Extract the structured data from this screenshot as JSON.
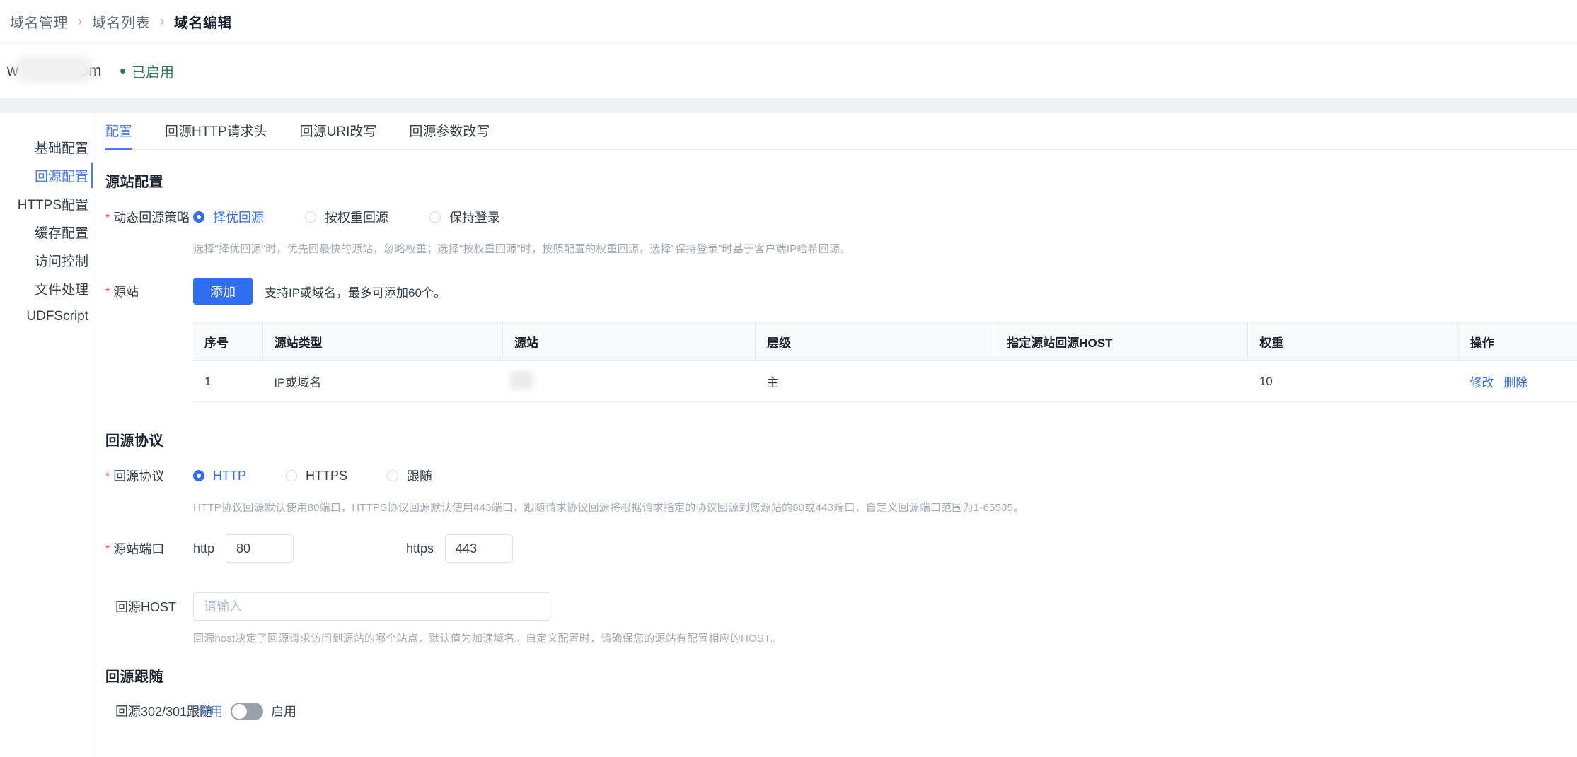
{
  "breadcrumb": {
    "items": [
      {
        "label": "域名管理",
        "current": false
      },
      {
        "label": "域名列表",
        "current": false
      },
      {
        "label": "域名编辑",
        "current": true
      }
    ],
    "separator": "›"
  },
  "domain_header": {
    "name_prefix": "w",
    "name_suffix": "om",
    "status": "已启用",
    "status_color": "#2e7d4f"
  },
  "sidebar": {
    "items": [
      {
        "label": "基础配置",
        "active": false
      },
      {
        "label": "回源配置",
        "active": true
      },
      {
        "label": "HTTPS配置",
        "active": false
      },
      {
        "label": "缓存配置",
        "active": false
      },
      {
        "label": "访问控制",
        "active": false
      },
      {
        "label": "文件处理",
        "active": false
      },
      {
        "label": "UDFScript",
        "active": false
      }
    ],
    "accent_color": "#4a7bf7"
  },
  "tabs": [
    {
      "label": "配置",
      "active": true
    },
    {
      "label": "回源HTTP请求头",
      "active": false
    },
    {
      "label": "回源URI改写",
      "active": false
    },
    {
      "label": "回源参数改写",
      "active": false
    }
  ],
  "origin_section": {
    "title": "源站配置",
    "policy": {
      "label": "动态回源策略",
      "required": true,
      "options": [
        {
          "label": "择优回源",
          "checked": true
        },
        {
          "label": "按权重回源",
          "checked": false
        },
        {
          "label": "保持登录",
          "checked": false
        }
      ],
      "hint": "选择\"择优回源\"时，优先回最快的源站，忽略权重；选择\"按权重回源\"时，按照配置的权重回源，选择\"保持登录\"时基于客户端IP哈希回源。"
    },
    "origin": {
      "label": "源站",
      "required": true,
      "add_button": "添加",
      "add_note": "支持IP或域名，最多可添加60个。"
    },
    "table": {
      "headers": [
        "序号",
        "源站类型",
        "源站",
        "层级",
        "指定源站回源HOST",
        "权重",
        "操作"
      ],
      "rows": [
        {
          "index": "1",
          "type": "IP或域名",
          "origin": "5",
          "level": "主",
          "host": "",
          "weight": "10",
          "actions": [
            "修改",
            "删除"
          ]
        }
      ]
    }
  },
  "protocol_section": {
    "title": "回源协议",
    "protocol": {
      "label": "回源协议",
      "required": true,
      "options": [
        {
          "label": "HTTP",
          "checked": true
        },
        {
          "label": "HTTPS",
          "checked": false
        },
        {
          "label": "跟随",
          "checked": false
        }
      ],
      "hint": "HTTP协议回源默认使用80端口，HTTPS协议回源默认使用443端口，跟随请求协议回源将根据请求指定的协议回源到您源站的80或443端口，自定义回源端口范围为1-65535。"
    },
    "ports": {
      "label": "源站端口",
      "required": true,
      "http_label": "http",
      "http_value": "80",
      "https_label": "https",
      "https_value": "443"
    },
    "host": {
      "label": "回源HOST",
      "required": false,
      "value": "",
      "placeholder": "请输入",
      "hint": "回源host决定了回源请求访问到源站的哪个站点，默认值为加速域名。自定义配置时，请确保您的源站有配置相应的HOST。"
    }
  },
  "follow_section": {
    "title": "回源跟随",
    "toggle": {
      "label": "回源302/301跟随",
      "off_label": "停用",
      "on_label": "启用",
      "enabled": false
    }
  }
}
